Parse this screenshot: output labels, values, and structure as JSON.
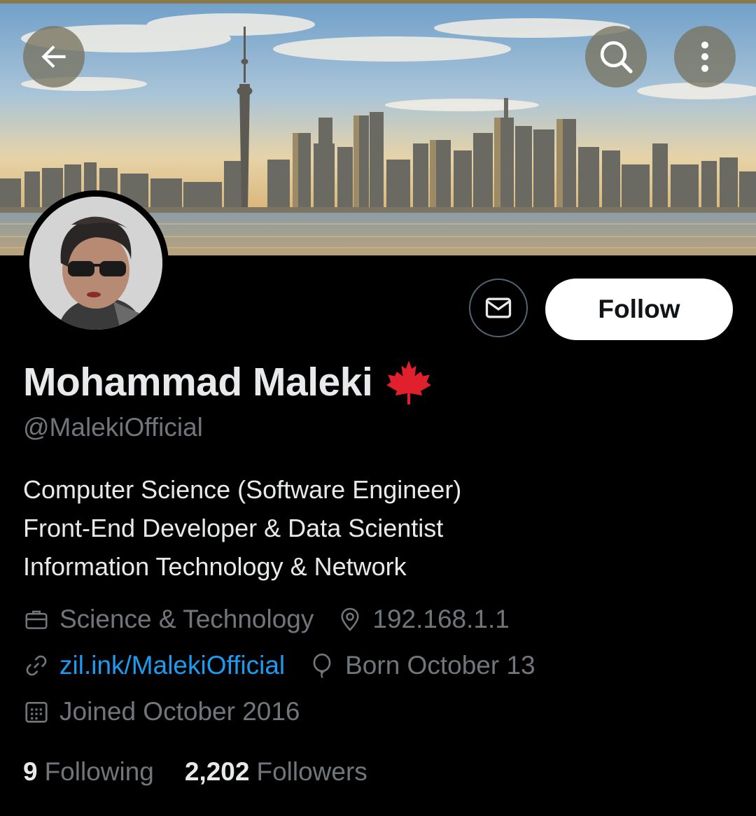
{
  "header": {
    "back_icon": "arrow-left-icon",
    "search_icon": "search-icon",
    "more_icon": "more-vertical-icon"
  },
  "profile": {
    "display_name": "Mohammad Maleki",
    "name_emoji": "maple-leaf-icon",
    "handle": "@MalekiOfficial",
    "bio": [
      "Computer Science (Software Engineer)",
      "Front-End Developer & Data Scientist",
      "Information Technology & Network"
    ],
    "category": "Science & Technology",
    "location": "192.168.1.1",
    "website": "zil.ink/MalekiOfficial",
    "birthday": "Born October 13",
    "joined": "Joined October 2016"
  },
  "actions": {
    "follow_label": "Follow"
  },
  "stats": {
    "following_count": "9",
    "following_label": "Following",
    "followers_count": "2,202",
    "followers_label": "Followers"
  },
  "colors": {
    "background": "#000000",
    "text_primary": "#e7e9ea",
    "text_secondary": "#71767b",
    "link": "#1d9bf0",
    "maple_leaf": "#e0202d"
  }
}
